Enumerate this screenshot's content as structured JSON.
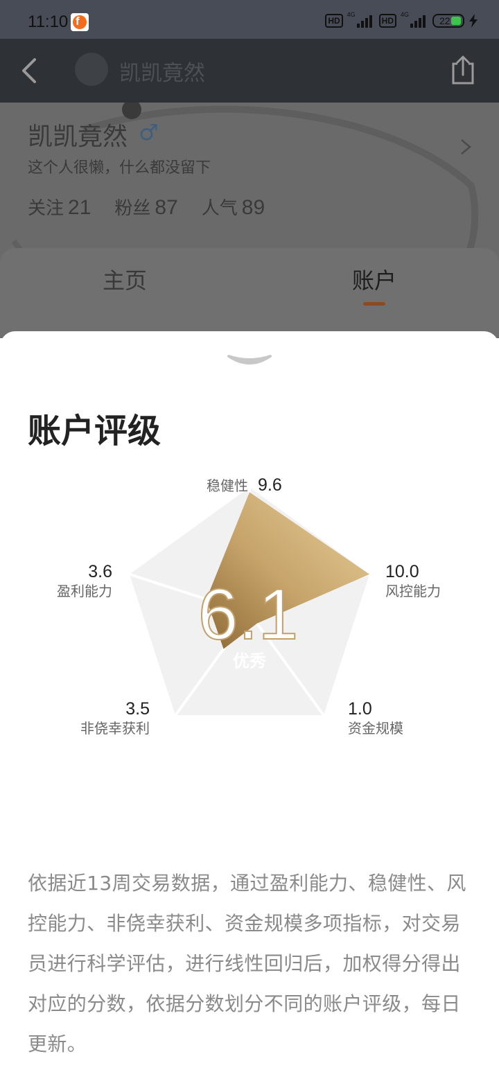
{
  "status_bar": {
    "time": "11:10",
    "app_badge": "f",
    "hd_label": "HD",
    "network": "4G",
    "battery": "22"
  },
  "toolbar": {
    "title": "凯凯竟然",
    "back_icon": "chevron-left-icon",
    "share_icon": "share-icon"
  },
  "profile": {
    "name": "凯凯竟然",
    "gender_symbol": "♂",
    "bio": "这个人很懒，什么都没留下",
    "stats": [
      {
        "label": "关注",
        "value": "21"
      },
      {
        "label": "粉丝",
        "value": "87"
      },
      {
        "label": "人气",
        "value": "89"
      }
    ]
  },
  "tabs": {
    "home": "主页",
    "account": "账户",
    "active": "account"
  },
  "sheet": {
    "title": "账户评级",
    "rating": {
      "score": "6.1",
      "grade": "优秀",
      "max": 10,
      "metrics": [
        {
          "name": "稳健性",
          "value": 9.6
        },
        {
          "name": "风控能力",
          "value": 10.0
        },
        {
          "name": "资金规模",
          "value": 1.0
        },
        {
          "name": "非侥幸获利",
          "value": 3.5
        },
        {
          "name": "盈利能力",
          "value": 3.6
        }
      ],
      "colors": {
        "fill_start": "#e8cf9c",
        "fill_end": "#8f6a36",
        "bg": "#f1f1f1"
      }
    },
    "description": "依据近13周交易数据，通过盈利能力、稳健性、风控能力、非侥幸获利、资金规模多项指标，对交易员进行科学评估，进行线性回归后，加权得分得出对应的分数，依据分数划分不同的账户评级，每日更新。"
  }
}
